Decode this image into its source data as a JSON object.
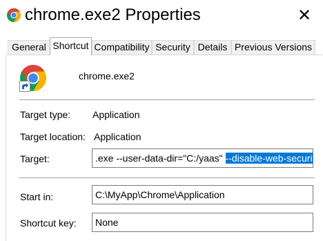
{
  "window": {
    "title": "chrome.exe2 Properties",
    "close_glyph": "✕",
    "icon": "chrome-icon"
  },
  "tabs": [
    {
      "label": "General",
      "active": false
    },
    {
      "label": "Shortcut",
      "active": true
    },
    {
      "label": "Compatibility",
      "active": false
    },
    {
      "label": "Security",
      "active": false
    },
    {
      "label": "Details",
      "active": false
    },
    {
      "label": "Previous Versions",
      "active": false
    }
  ],
  "shortcut": {
    "icon": "chrome-shortcut-icon",
    "name": "chrome.exe2",
    "target_type_label": "Target type:",
    "target_type_value": "Application",
    "target_location_label": "Target location:",
    "target_location_value": "Application",
    "target_label": "Target:",
    "target_value_unselected": ".exe --user-data-dir=\"C:/yaas\" ",
    "target_value_selected": "--disable-web-security",
    "start_in_label": "Start in:",
    "start_in_value": "C:\\MyApp\\Chrome\\Application",
    "shortcut_key_label": "Shortcut key:",
    "shortcut_key_value": "None"
  },
  "colors": {
    "selection": "#0078d7",
    "chrome_red": "#db4437",
    "chrome_green": "#0f9d58",
    "chrome_yellow": "#f4b400",
    "chrome_blue": "#4285f4"
  }
}
